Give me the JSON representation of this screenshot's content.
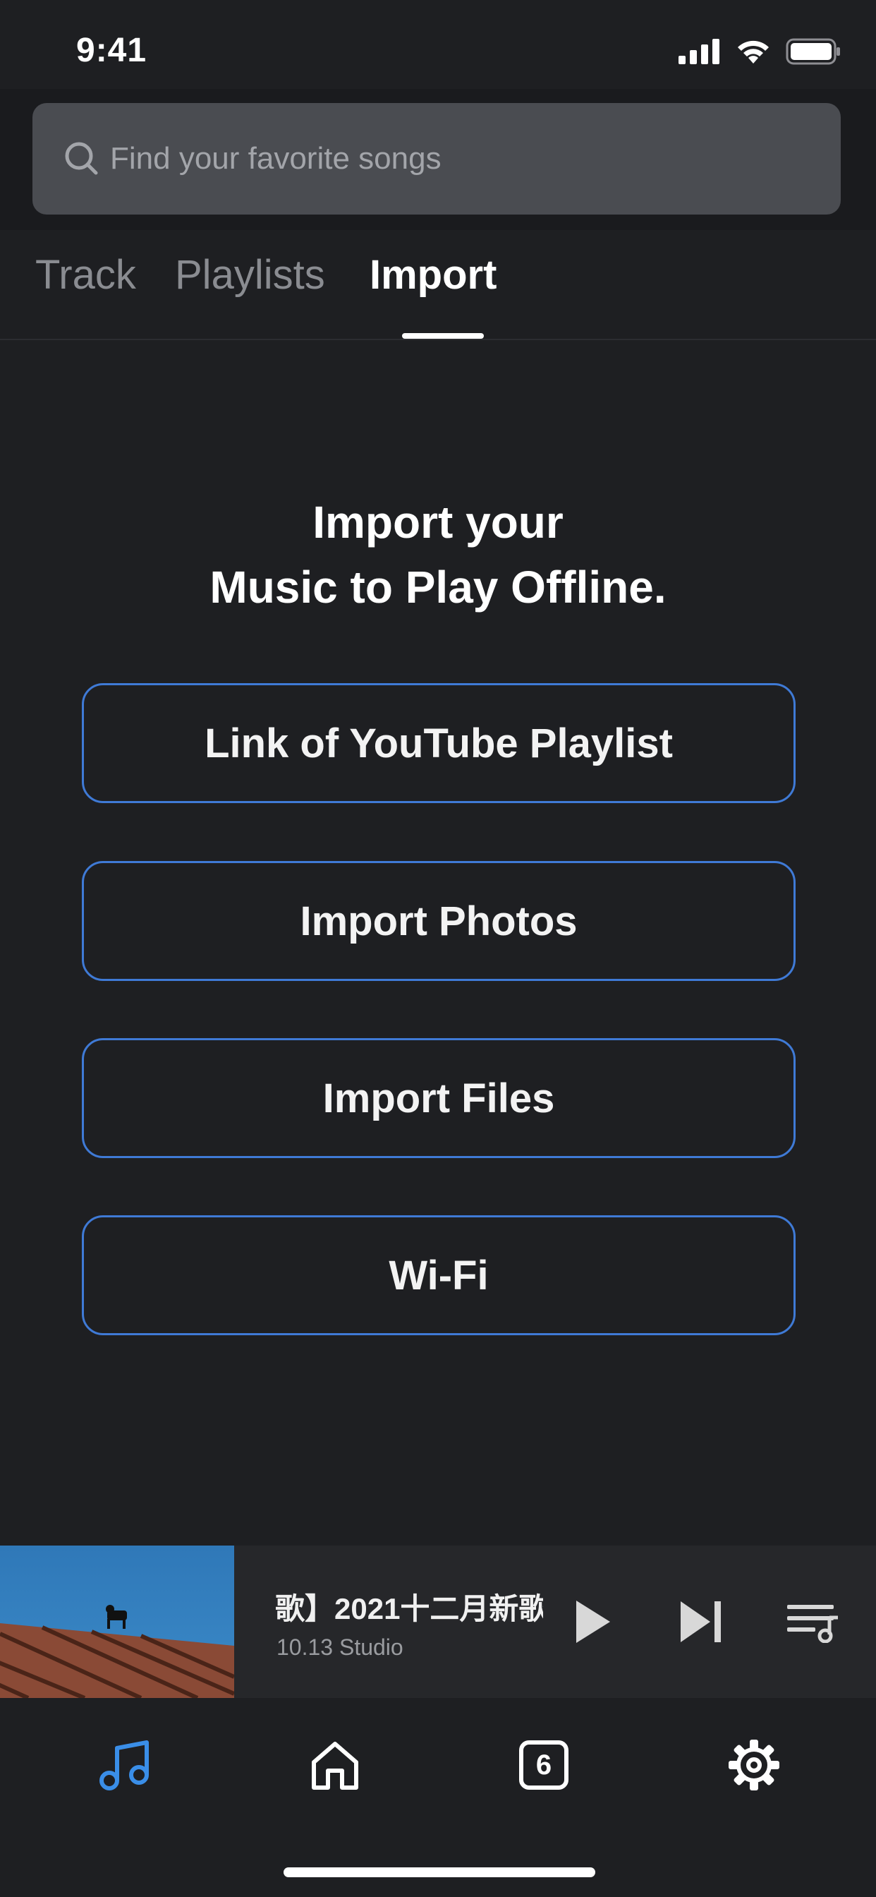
{
  "status_bar": {
    "time": "9:41"
  },
  "search": {
    "placeholder": "Find your favorite songs"
  },
  "tabs": [
    {
      "label": "Track",
      "active": false
    },
    {
      "label": "Playlists",
      "active": false
    },
    {
      "label": "Import",
      "active": true
    }
  ],
  "main": {
    "headline_line1": "Import your",
    "headline_line2": "Music to Play Offline.",
    "buttons": [
      {
        "label": "Link of YouTube Playlist"
      },
      {
        "label": "Import Photos"
      },
      {
        "label": "Import Files"
      },
      {
        "label": "Wi-Fi"
      }
    ]
  },
  "mini_player": {
    "title": "歌】2021十二月新歌",
    "artist": "10.13 Studio"
  },
  "bottom_nav": {
    "tabs_count": "6"
  },
  "colors": {
    "background": "#1e1f22",
    "accent_blue": "#3f7ad6",
    "nav_active": "#3a8ee8",
    "search_field": "#4a4c51"
  },
  "icons": [
    "search-icon",
    "signal-icon",
    "wifi-icon",
    "battery-icon",
    "play-icon",
    "skip-next-icon",
    "queue-music-icon",
    "music-note-icon",
    "home-icon",
    "tabs-count-icon",
    "gear-icon"
  ]
}
